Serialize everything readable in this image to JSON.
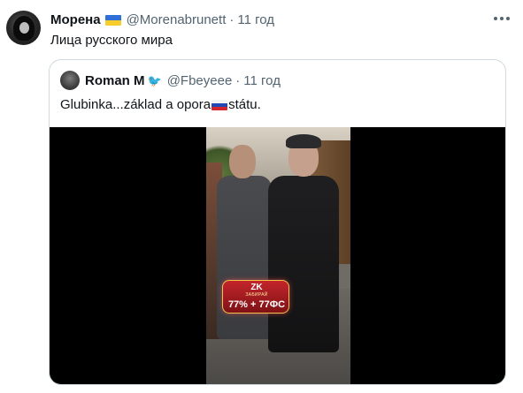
{
  "tweet": {
    "author_name": "Морена",
    "handle": "@Morenabrunett",
    "time": "11 год",
    "text": "Лица русского мира",
    "separator": "·"
  },
  "quoted_tweet": {
    "author_name": "Roman M",
    "handle": "@Fbeyeee",
    "time": "11 год",
    "separator": "·",
    "text_before_flag": "Glubinka...základ a opora",
    "text_after_flag": "státu."
  },
  "video_overlay": {
    "logo": "ZK",
    "subtitle": "ЗАБИРАЙ",
    "promo": "77% + 77ФС"
  },
  "icons": {
    "more": "more-horizontal-icon",
    "flag_ua": "ukraine-flag-icon",
    "bird": "bird-icon",
    "flag_ru": "russia-flag-icon"
  },
  "colors": {
    "text": "#0f1419",
    "secondary": "#536471",
    "border": "#cfd9de"
  }
}
